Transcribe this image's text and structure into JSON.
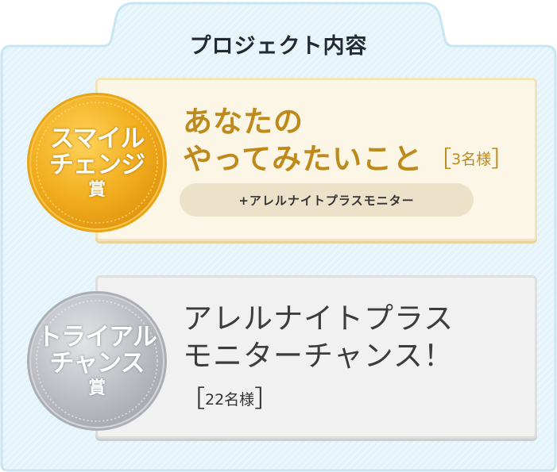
{
  "section": {
    "title": "プロジェクト内容"
  },
  "colors": {
    "panel": "#e6f4fa",
    "panel_border": "#c9e7f3",
    "gold": "#f3b52b",
    "gold_text": "#bf8a1c",
    "silver": "#b9bcc1",
    "pill": "#ebe2c9"
  },
  "awards": [
    {
      "medal": {
        "line1": "スマイル",
        "line2": "チェンジ",
        "line3": "賞"
      },
      "title_line1": "あなたの",
      "title_line2": "やってみたいこと",
      "count_open": "［",
      "count": "3名様",
      "count_close": "］",
      "extra": "+アレルナイトプラスモニター"
    },
    {
      "medal": {
        "line1": "トライアル",
        "line2": "チャンス",
        "line3": "賞"
      },
      "title_line1": "アレルナイトプラス",
      "title_line2": "モニターチャンス！",
      "count_open": "［",
      "count": "22名様",
      "count_close": "］"
    }
  ]
}
